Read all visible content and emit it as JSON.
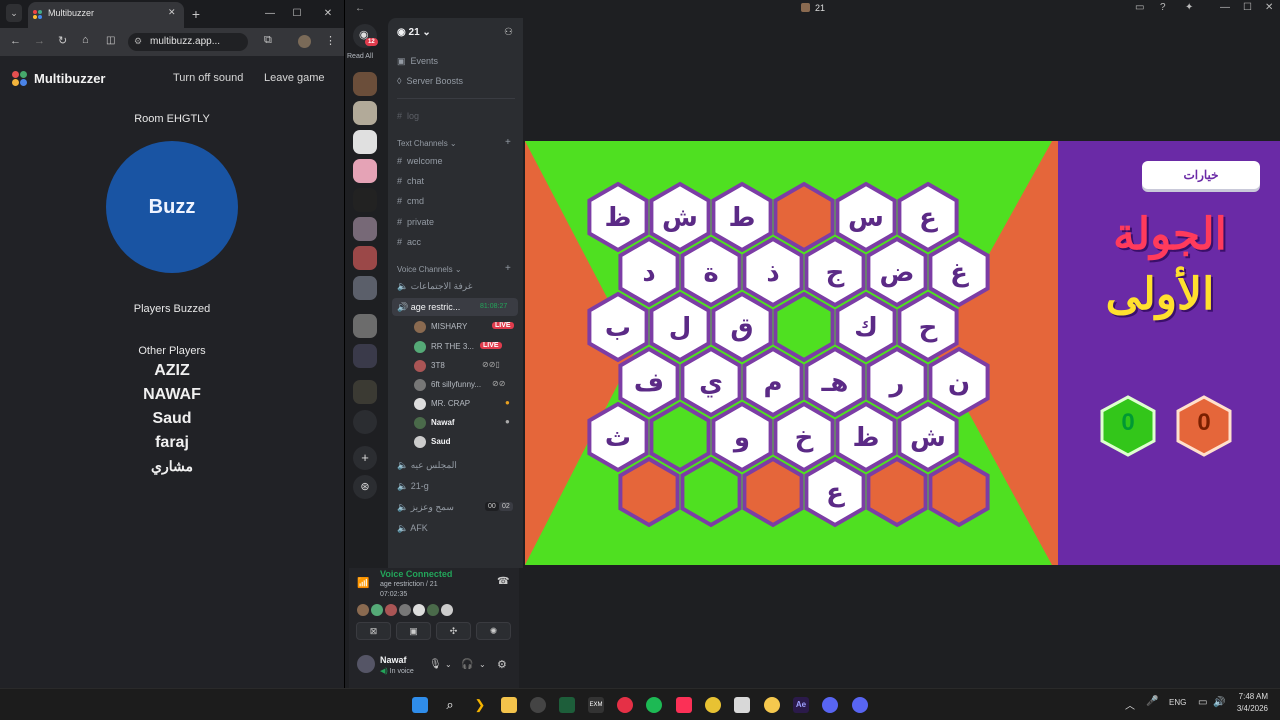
{
  "browser": {
    "tab_title": "Multibuzzer",
    "url": "multibuzz.app...",
    "new_tab": "+",
    "min": "—",
    "max": "☐",
    "close": "✕"
  },
  "multibuzzer": {
    "brand": "Multibuzzer",
    "sound_toggle": "Turn off sound",
    "leave": "Leave game",
    "room": "Room EHGTLY",
    "buzz": "Buzz",
    "buzzed_heading": "Players Buzzed",
    "other_heading": "Other Players",
    "players": [
      "AZIZ",
      "NAWAF",
      "Saud",
      "faraj",
      "مشاري"
    ]
  },
  "discord": {
    "title": "21",
    "server_name": "21",
    "read_all": "Read All",
    "badge": "12",
    "events": "Events",
    "boosts": "Server Boosts",
    "log": "log",
    "text_cat": "Text Channels",
    "text_channels": [
      "welcome",
      "chat",
      "cmd",
      "private",
      "acc"
    ],
    "voice_cat": "Voice Channels",
    "voice_channels": [
      {
        "name": "غرفة الاجتماعات"
      },
      {
        "name": "age restric...",
        "timer": "81:08:27"
      }
    ],
    "voice_users": [
      {
        "name": "MISHARY",
        "live": "LIVE"
      },
      {
        "name": "RR THE 3...",
        "live": "LIVE"
      },
      {
        "name": "3T8"
      },
      {
        "name": "6ft sillyfunny..."
      },
      {
        "name": "MR. CRAP"
      },
      {
        "name": "Nawaf"
      },
      {
        "name": "Saud"
      }
    ],
    "more_voice": [
      "المجلس عيه",
      "21-g",
      "سمح وعزيز",
      "AFK"
    ],
    "counter": [
      "00",
      "02"
    ],
    "voice_connected": "Voice Connected",
    "voice_path": "age restriction / 21",
    "voice_time": "07:02:35",
    "user": "Nawaf",
    "user_status": "In voice"
  },
  "game": {
    "options": "خيارات",
    "round_line1": "الجولة",
    "round_line2": "الأولى",
    "score_green": "0",
    "score_orange": "0",
    "rows": [
      [
        "ظ",
        "ش",
        "ط",
        "",
        "س",
        "ع"
      ],
      [
        "د",
        "ة",
        "ذ",
        "ج",
        "ض",
        "غ"
      ],
      [
        "ب",
        "ل",
        "ق",
        "",
        "ك",
        "ح"
      ],
      [
        "ف",
        "ي",
        "م",
        "هـ",
        "ر",
        "ن"
      ],
      [
        "ث",
        "",
        "و",
        "خ",
        "ظ",
        "ش"
      ],
      [
        "",
        "",
        "",
        "ع",
        "",
        ""
      ]
    ],
    "colors": {
      "green": "#4fe021",
      "orange": "#e5663a",
      "purple": "#6a2aa6",
      "hex_border": "#7c3da5",
      "white": "#ffffff"
    }
  },
  "taskbar": {
    "lang": "ENG",
    "time": "7:48 AM",
    "date": "3/4/2026"
  }
}
